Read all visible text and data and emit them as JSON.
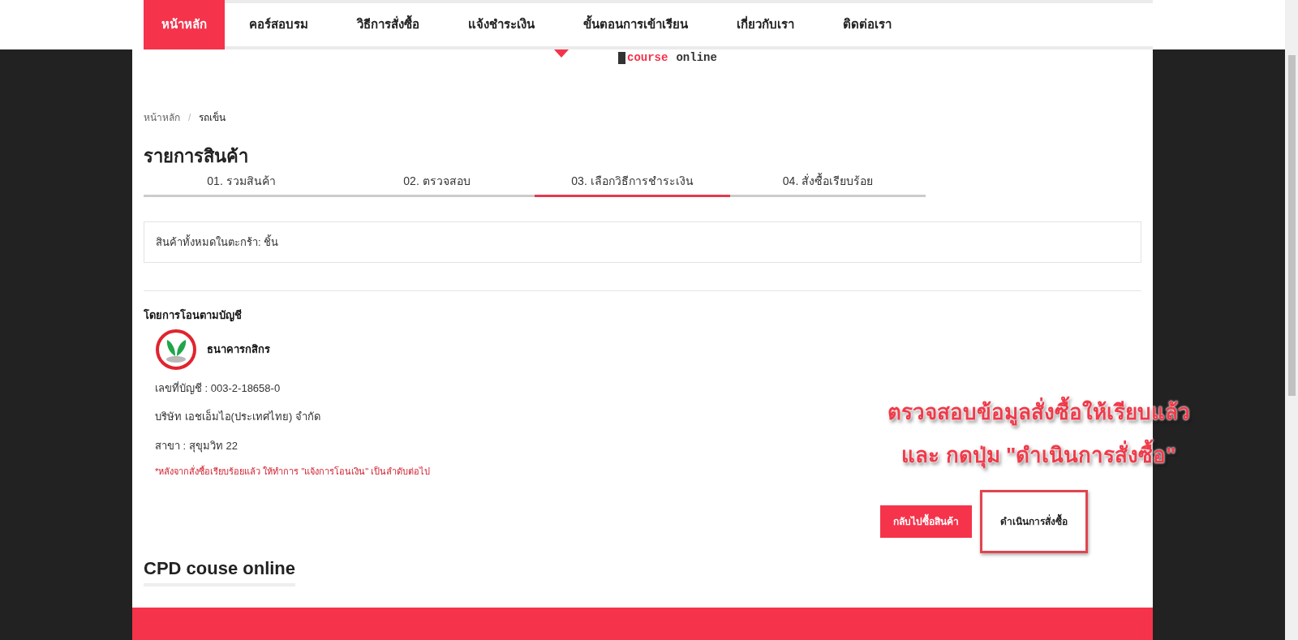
{
  "nav": [
    {
      "label": "หน้าหลัก",
      "selected": true
    },
    {
      "label": "คอร์สอบรม",
      "selected": false
    },
    {
      "label": "วิธีการสั่งซื้อ",
      "selected": false
    },
    {
      "label": "แจ้งชำระเงิน",
      "selected": false
    },
    {
      "label": "ขั้นตอนการเข้าเรียน",
      "selected": false
    },
    {
      "label": "เกี่ยวกับเรา",
      "selected": false
    },
    {
      "label": "ติดต่อเรา",
      "selected": false
    }
  ],
  "logo": {
    "word_1": "course",
    "word_2": "online"
  },
  "breadcrumb": [
    {
      "label": "หน้าหลัก"
    },
    {
      "label": "/"
    },
    {
      "label": "รถเข็น"
    }
  ],
  "title": "รายการสินค้า",
  "steps": [
    {
      "label": "01. รวมสินค้า",
      "selected": false
    },
    {
      "label": "02. ตรวจสอบ",
      "selected": false
    },
    {
      "label": "03. เลือกวิธีการชำระเงิน",
      "selected": true
    },
    {
      "label": "04. สั่งซื้อเรียบร้อย",
      "selected": false
    }
  ],
  "cart_summary": "สินค้าทั้งหมดในตะกร้า: ชิ้น",
  "payment": {
    "heading": "โดยการโอนตามบัญชี",
    "bank_name": "ธนาคารกสิกร",
    "lines": [
      "เลขที่บัญชี : 003-2-18658-0",
      "บริษัท เอชเอ็มไอ(ประเทศไทย) จำกัด",
      "สาขา : สุขุมวิท 22"
    ],
    "note": "*หลังจากสั่งซื้อเรียบร้อยแล้ว ให้ทำการ \"แจ้งการโอนเงิน\" เป็นลำดับต่อไป"
  },
  "annotation": [
    "ตรวจสอบข้อมูลสั่งซื้อให้เรียบแล้ว",
    "และ กดปุ่ม \"ดำเนินการสั่งซื้อ\""
  ],
  "buttons": [
    {
      "label": "กลับไปซื้อสินค้า",
      "kind": "primary"
    },
    {
      "label": "ดำเนินการสั่งซื้อ",
      "kind": "outline"
    }
  ],
  "footer_title": "CPD couse online"
}
